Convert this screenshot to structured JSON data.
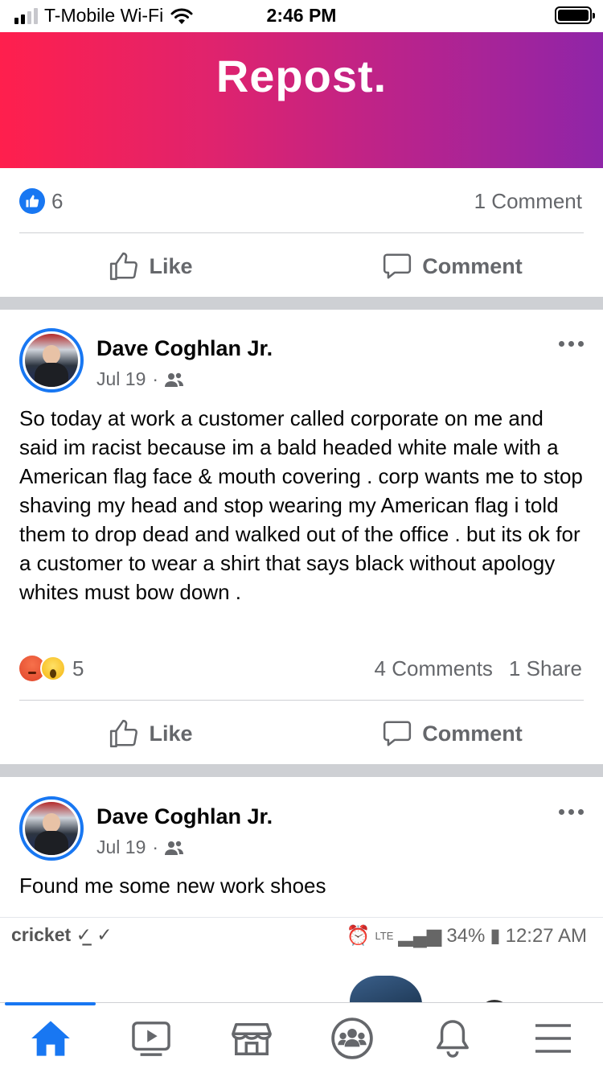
{
  "status_bar": {
    "carrier": "T-Mobile Wi-Fi",
    "time": "2:46 PM",
    "signal_bars": 4,
    "signal_bars_filled": 2,
    "battery_level": 1.0
  },
  "banner": {
    "text": "Repost.",
    "gradient_colors": [
      "#ff1f4d",
      "#8f25a8"
    ]
  },
  "post1_footer": {
    "reaction_icons": [
      "like-icon"
    ],
    "reaction_count": "6",
    "comments": "1 Comment",
    "like_label": "Like",
    "comment_label": "Comment"
  },
  "post2": {
    "author": "Dave Coghlan Jr.",
    "date": "Jul 19",
    "audience_icon": "friends-icon",
    "text": "So today at work a customer called corporate on me and said im racist because im a bald headed white male with a American flag face & mouth covering . corp wants me to stop shaving my head and stop wearing my American flag i told them to drop dead and walked out of the office . but its ok for a customer to wear a shirt that says black without apology whites must bow down .",
    "reaction_icons": [
      "angry-icon",
      "wow-icon"
    ],
    "reaction_count": "5",
    "comments": "4 Comments",
    "shares": "1 Share",
    "like_label": "Like",
    "comment_label": "Comment"
  },
  "post3": {
    "author": "Dave Coghlan Jr.",
    "date": "Jul 19",
    "audience_icon": "friends-icon",
    "text": "Found me some new work shoes",
    "embed": {
      "carrier": "cricket",
      "battery": "34%",
      "time": "12:27 AM",
      "network": "LTE"
    }
  },
  "tabbar": {
    "items": [
      "home-icon",
      "watch-icon",
      "marketplace-icon",
      "groups-icon",
      "notifications-icon",
      "menu-icon"
    ],
    "active": "home-icon",
    "accent": "#1877f2"
  },
  "colors": {
    "accent": "#1877f2",
    "secondary_text": "#65676b",
    "separator": "#ced0d4"
  }
}
